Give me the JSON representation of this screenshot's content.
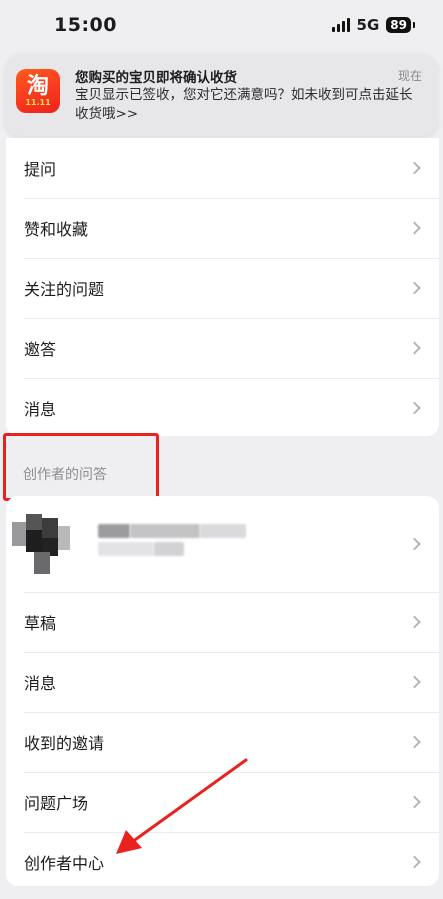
{
  "status_bar": {
    "time": "15:00",
    "network": "5G",
    "battery": "89"
  },
  "notification": {
    "app_icon_glyph": "淘",
    "app_icon_sub": "11.11",
    "title": "您购买的宝贝即将确认收货",
    "time": "现在",
    "body": "宝贝显示已签收，您对它还满意吗？如未收到可点击延长收货哦>>"
  },
  "top_section": {
    "items": [
      {
        "label": "提问"
      },
      {
        "label": "赞和收藏"
      },
      {
        "label": "关注的问题"
      },
      {
        "label": "邀答"
      },
      {
        "label": "消息"
      }
    ]
  },
  "creator_section": {
    "header": "创作者的问答",
    "items": [
      {
        "label": "草稿"
      },
      {
        "label": "消息"
      },
      {
        "label": "收到的邀请"
      },
      {
        "label": "问题广场"
      },
      {
        "label": "创作者中心"
      }
    ]
  },
  "colors": {
    "annotation_red": "#e8231f",
    "background": "#efeff1"
  }
}
